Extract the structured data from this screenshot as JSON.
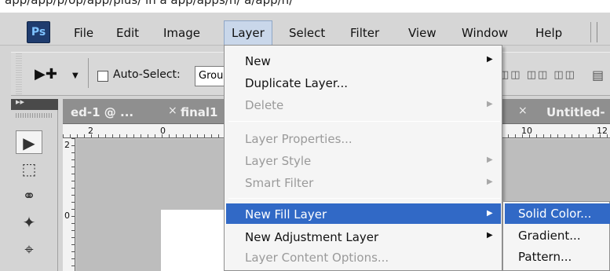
{
  "top_strip_text": "app/app/p/op/app/plus/ in a app/apps/n/ a/app/n/",
  "app": {
    "logo": "Ps"
  },
  "menubar": {
    "items": [
      "File",
      "Edit",
      "Image",
      "Layer",
      "Select",
      "Filter",
      "View",
      "Window",
      "Help"
    ],
    "active": "Layer"
  },
  "options_bar": {
    "auto_select_label": "Auto-Select:",
    "auto_select_checked": false,
    "group_value": "Grou"
  },
  "tabs": [
    {
      "label": "ed-1 @ ...",
      "close": "×"
    },
    {
      "label": "final1",
      "close": ""
    },
    {
      "label": "Untitled-",
      "close": "×"
    }
  ],
  "rulers": {
    "top_labels": [
      "2",
      "0",
      "10",
      "12"
    ],
    "left_labels": [
      "2",
      "0"
    ]
  },
  "tools": [
    "move-tool",
    "marquee-tool",
    "lasso-tool",
    "magic-wand-tool",
    "crop-tool"
  ],
  "layer_menu": {
    "items": [
      {
        "label": "New",
        "disabled": false,
        "submenu": true
      },
      {
        "label": "Duplicate Layer...",
        "disabled": false,
        "submenu": false
      },
      {
        "label": "Delete",
        "disabled": true,
        "submenu": true
      },
      {
        "label": "Layer Properties...",
        "disabled": true,
        "submenu": false
      },
      {
        "label": "Layer Style",
        "disabled": true,
        "submenu": true
      },
      {
        "label": "Smart Filter",
        "disabled": true,
        "submenu": true
      },
      {
        "label": "New Fill Layer",
        "disabled": false,
        "submenu": true,
        "highlighted": true
      },
      {
        "label": "New Adjustment Layer",
        "disabled": false,
        "submenu": true
      },
      {
        "label": "Layer Content Options...",
        "disabled": true,
        "submenu": false
      }
    ]
  },
  "fill_layer_submenu": {
    "items": [
      "Solid Color...",
      "Gradient...",
      "Pattern..."
    ],
    "highlighted": "Solid Color..."
  },
  "colors": {
    "highlight": "#3169c6",
    "menu_bg": "#f5f5f5",
    "disabled_text": "#9a9a9a",
    "ps_logo_bg": "#1f3c6e",
    "tab_bar": "#8f8f8f"
  }
}
